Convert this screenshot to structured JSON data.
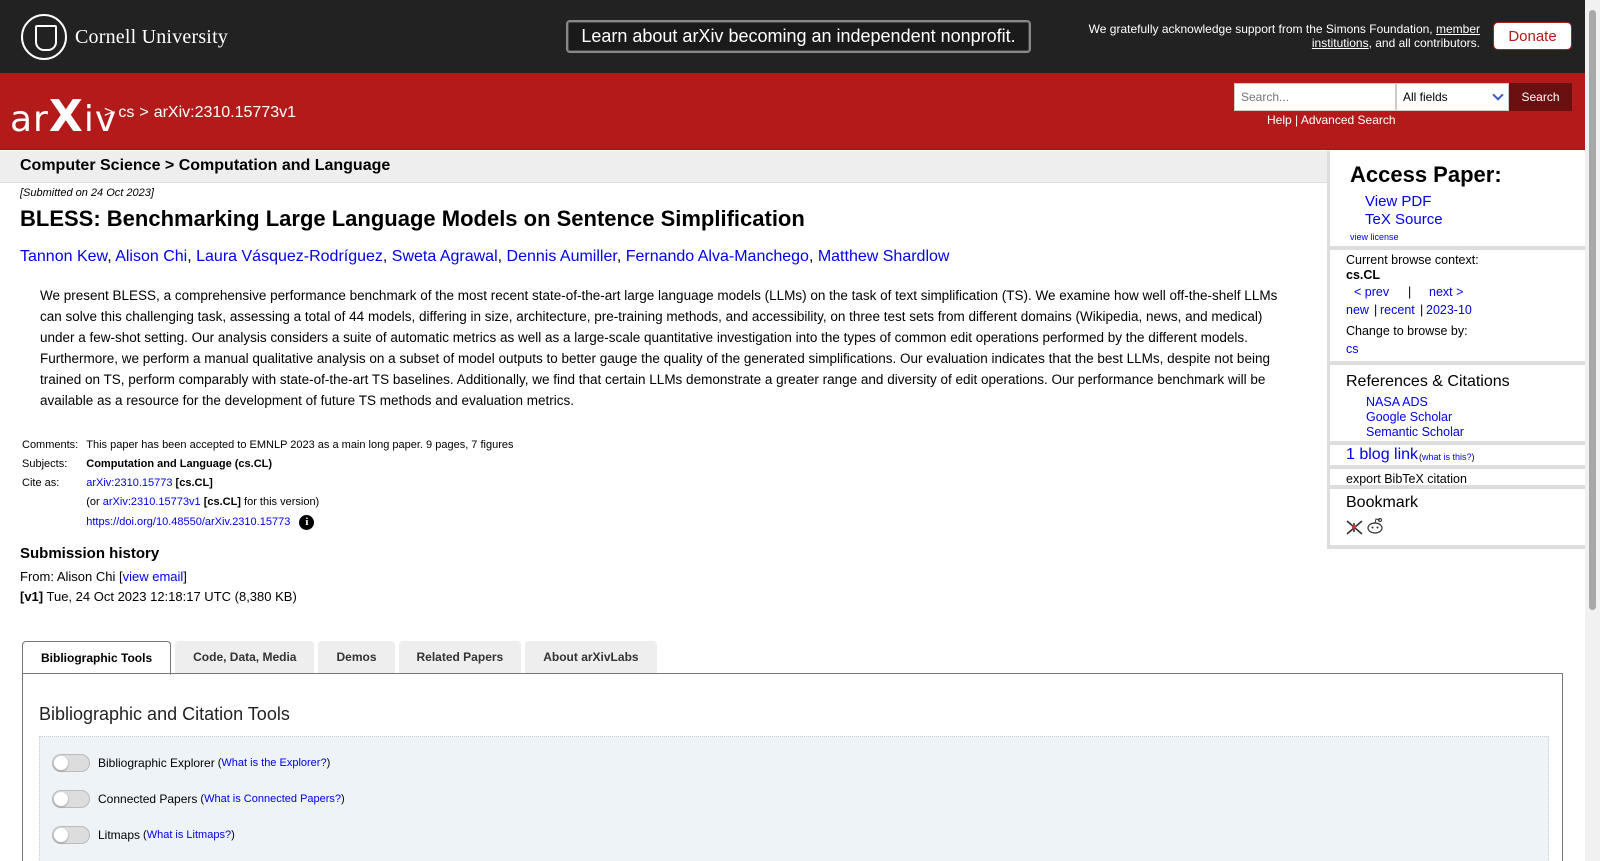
{
  "top_bar": {
    "university": "Cornell University",
    "nonprofit_banner": "Learn about arXiv becoming an independent nonprofit.",
    "support_prefix": "We gratefully acknowledge support from the Simons Foundation,",
    "support_link": "member institutions",
    "support_suffix": ", and all contributors.",
    "donate_label": "Donate"
  },
  "header": {
    "logo_a": "ar",
    "logo_x": "X",
    "logo_b": "iv",
    "breadcrumb": [
      ">",
      "cs",
      ">",
      "arXiv:2310.15773v1"
    ],
    "search_placeholder": "Search...",
    "field_select": "All fields",
    "search_button": "Search",
    "help": "Help",
    "separator": "|",
    "advanced": "Advanced Search"
  },
  "subject_bar": "Computer Science > Computation and Language",
  "paper": {
    "submitted": "[Submitted on 24 Oct 2023]",
    "title": "BLESS: Benchmarking Large Language Models on Sentence Simplification",
    "authors": [
      "Tannon Kew",
      "Alison Chi",
      "Laura Vásquez-Rodríguez",
      "Sweta Agrawal",
      "Dennis Aumiller",
      "Fernando Alva-Manchego",
      "Matthew Shardlow"
    ],
    "abstract": "We present BLESS, a comprehensive performance benchmark of the most recent state-of-the-art large language models (LLMs) on the task of text simplification (TS). We examine how well off-the-shelf LLMs can solve this challenging task, assessing a total of 44 models, differing in size, architecture, pre-training methods, and accessibility, on three test sets from different domains (Wikipedia, news, and medical) under a few-shot setting. Our analysis considers a suite of automatic metrics as well as a large-scale quantitative investigation into the types of common edit operations performed by the different models. Furthermore, we perform a manual qualitative analysis on a subset of model outputs to better gauge the quality of the generated simplifications. Our evaluation indicates that the best LLMs, despite not being trained on TS, perform comparably with state-of-the-art TS baselines. Additionally, we find that certain LLMs demonstrate a greater range and diversity of edit operations. Our performance benchmark will be available as a resource for the development of future TS methods and evaluation metrics.",
    "comments_label": "Comments:",
    "comments": "This paper has been accepted to EMNLP 2023 as a main long paper. 9 pages, 7 figures",
    "subjects_label": "Subjects:",
    "subjects": "Computation and Language (cs.CL)",
    "cite_label": "Cite as:",
    "cite_id": "arXiv:2310.15773",
    "cite_tag": "[cs.CL]",
    "or_prefix": "(or",
    "version_id": "arXiv:2310.15773v1",
    "version_tag": "[cs.CL]",
    "version_suffix": "for this version)",
    "doi": "https://doi.org/10.48550/arXiv.2310.15773",
    "doi_info_icon": "i"
  },
  "history": {
    "title": "Submission history",
    "from_prefix": "From: Alison Chi [",
    "view_email": "view email",
    "from_suffix": "]",
    "v1_label": "[v1]",
    "v1_text": "Tue, 24 Oct 2023 12:18:17 UTC (8,380 KB)"
  },
  "tabs": [
    "Bibliographic Tools",
    "Code, Data, Media",
    "Demos",
    "Related Papers",
    "About arXivLabs"
  ],
  "panel": {
    "title": "Bibliographic and Citation Tools",
    "tools": [
      {
        "name": "Bibliographic Explorer",
        "link": "What is the Explorer?"
      },
      {
        "name": "Connected Papers",
        "link": "What is Connected Papers?"
      },
      {
        "name": "Litmaps",
        "link": "What is Litmaps?"
      }
    ]
  },
  "sidebar": {
    "access_title": "Access Paper:",
    "view_pdf": "View PDF",
    "tex_source": "TeX Source",
    "view_license": "view license",
    "browse_context_label": "Current browse context:",
    "browse_context": "cs.CL",
    "prev": "< prev",
    "pipe": "|",
    "next": "next >",
    "new": "new",
    "recent": "recent",
    "month": "2023-10",
    "change_browse": "Change to browse by:",
    "cs": "cs",
    "refs_title": "References & Citations",
    "nasa": "NASA ADS",
    "google": "Google Scholar",
    "semantic": "Semantic Scholar",
    "blog_link": "1 blog link",
    "what_is_this": "what is this?",
    "export_bibtex": "export BibTeX citation",
    "bookmark_title": "Bookmark"
  },
  "colors": {
    "arxiv_red": "#b31b1b",
    "top_bar": "#222222",
    "link": "#0000ee"
  }
}
